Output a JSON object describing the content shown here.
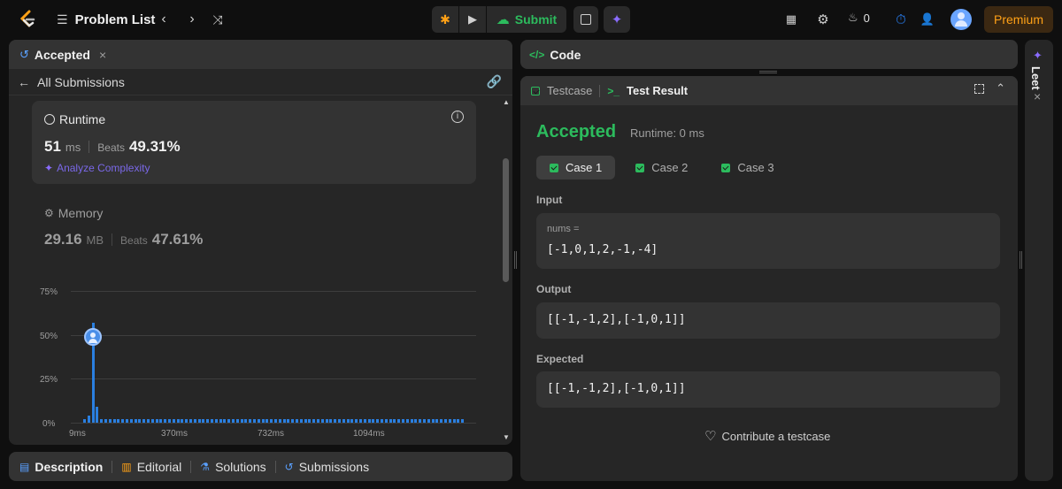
{
  "topbar": {
    "problem_list": "Problem List",
    "submit": "Submit",
    "streak_count": "0",
    "premium": "Premium"
  },
  "left_panel": {
    "tab_title": "Accepted",
    "back_label": "All Submissions",
    "runtime": {
      "title": "Runtime",
      "value": "51",
      "unit": "ms",
      "beats_label": "Beats",
      "beats_value": "49.31%",
      "analyze": "Analyze Complexity"
    },
    "memory": {
      "title": "Memory",
      "value": "29.16",
      "unit": "MB",
      "beats_label": "Beats",
      "beats_value": "47.61%"
    }
  },
  "chart_data": {
    "type": "bar",
    "ytick_labels": [
      "75%",
      "50%",
      "25%",
      "0%"
    ],
    "xtick_labels": [
      "9ms",
      "370ms",
      "732ms",
      "1094ms"
    ],
    "ylim": [
      0,
      75
    ],
    "highlight": {
      "x": "51ms",
      "value": 57
    },
    "values": [
      2,
      4,
      57,
      9,
      2,
      2,
      2,
      2,
      2,
      2,
      2,
      2,
      2,
      2,
      2,
      2,
      2,
      2,
      2,
      2,
      2,
      2,
      2,
      2,
      2,
      2,
      2,
      2,
      2,
      2,
      2,
      2,
      2,
      2,
      2,
      2,
      2,
      2,
      2,
      2,
      2,
      2,
      2,
      2,
      2,
      2,
      2,
      2,
      2,
      2,
      2,
      2,
      2,
      2,
      2,
      2,
      2,
      2,
      2,
      2,
      2,
      2,
      2,
      2,
      2,
      2,
      2,
      2,
      2,
      2,
      2,
      2,
      2,
      2,
      2,
      2,
      2,
      2,
      2,
      2,
      2,
      2,
      2,
      2,
      2,
      2,
      2,
      2,
      2,
      2
    ],
    "grid": true
  },
  "bottom_tabs": [
    "Description",
    "Editorial",
    "Solutions",
    "Submissions"
  ],
  "code_panel": {
    "title": "Code"
  },
  "result_panel": {
    "tab_testcase": "Testcase",
    "tab_result": "Test Result",
    "status": "Accepted",
    "runtime": "Runtime: 0 ms",
    "cases": [
      "Case 1",
      "Case 2",
      "Case 3"
    ],
    "input_label": "Input",
    "input_var": "nums =",
    "input_value": "[-1,0,1,2,-1,-4]",
    "output_label": "Output",
    "output_value": "[[-1,-1,2],[-1,0,1]]",
    "expected_label": "Expected",
    "expected_value": "[[-1,-1,2],[-1,0,1]]",
    "contribute": "Contribute a testcase"
  },
  "side_tab": {
    "label": "Leet"
  },
  "colors": {
    "accent_green": "#2cbb5d",
    "chart_blue": "#2a7fe0",
    "premium": "#ffa116"
  }
}
